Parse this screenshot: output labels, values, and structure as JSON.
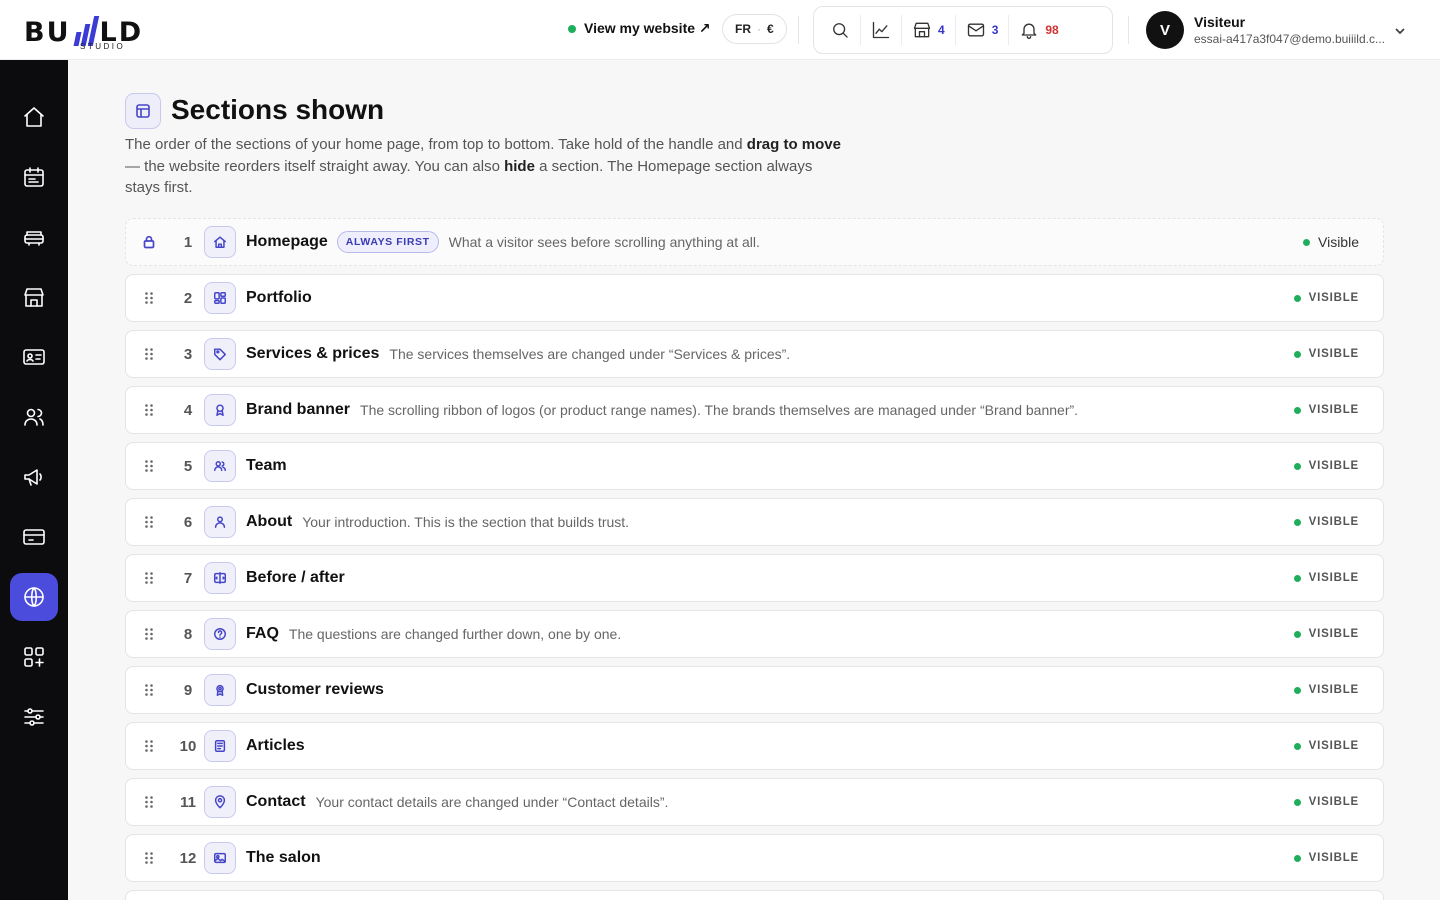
{
  "brand": {
    "name_left": "BU",
    "name_right": "LD",
    "sub": "STUDIO",
    "accent": "#3b3bd6"
  },
  "header": {
    "view_site": "View my website ↗",
    "lang": "FR",
    "currency": "€",
    "counts": {
      "shop": "4",
      "mail": "3",
      "bell": "98"
    },
    "user": {
      "initial": "V",
      "name": "Visiteur",
      "email": "essai-a417a3f047@demo.buiiild.c..."
    }
  },
  "sidebar": {
    "items": [
      {
        "icon": "home-icon"
      },
      {
        "icon": "calendar-icon"
      },
      {
        "icon": "services-icon"
      },
      {
        "icon": "storefront-icon"
      },
      {
        "icon": "contact-card-icon"
      },
      {
        "icon": "users-icon"
      },
      {
        "icon": "megaphone-icon"
      },
      {
        "icon": "payment-icon"
      },
      {
        "icon": "globe-icon",
        "active": true
      },
      {
        "icon": "apps-icon"
      },
      {
        "icon": "settings-sliders-icon"
      }
    ]
  },
  "page": {
    "title": "Sections shown",
    "intro_1": "The order of the sections of your home page, from top to bottom. Take hold of the handle and ",
    "intro_b1": "drag to move",
    "intro_2": " — the website reorders itself straight away. You can also ",
    "intro_b2": "hide",
    "intro_3": " a section. The Homepage section always stays first."
  },
  "sections": [
    {
      "num": "1",
      "name": "Homepage",
      "badge": "ALWAYS FIRST",
      "desc": "What a visitor sees before scrolling anything at all.",
      "status": "Visible",
      "icon": "home-icon"
    },
    {
      "num": "2",
      "name": "Portfolio",
      "desc": "",
      "status": "VISIBLE",
      "icon": "grid-icon"
    },
    {
      "num": "3",
      "name": "Services & prices",
      "desc": "The services themselves are changed under “Services & prices”.",
      "status": "VISIBLE",
      "icon": "tag-icon"
    },
    {
      "num": "4",
      "name": "Brand banner",
      "desc": "The scrolling ribbon of logos (or product range names). The brands themselves are managed under “Brand banner”.",
      "status": "VISIBLE",
      "icon": "award-icon"
    },
    {
      "num": "5",
      "name": "Team",
      "desc": "",
      "status": "VISIBLE",
      "icon": "team-icon"
    },
    {
      "num": "6",
      "name": "About",
      "desc": "Your introduction. This is the section that builds trust.",
      "status": "VISIBLE",
      "icon": "person-icon"
    },
    {
      "num": "7",
      "name": "Before / after",
      "desc": "",
      "status": "VISIBLE",
      "icon": "compare-icon"
    },
    {
      "num": "8",
      "name": "FAQ",
      "desc": "The questions are changed further down, one by one.",
      "status": "VISIBLE",
      "icon": "question-icon"
    },
    {
      "num": "9",
      "name": "Customer reviews",
      "desc": "",
      "status": "VISIBLE",
      "icon": "medal-icon"
    },
    {
      "num": "10",
      "name": "Articles",
      "desc": "",
      "status": "VISIBLE",
      "icon": "article-icon"
    },
    {
      "num": "11",
      "name": "Contact",
      "desc": "Your contact details are changed under “Contact details”.",
      "status": "VISIBLE",
      "icon": "location-pin-icon"
    },
    {
      "num": "12",
      "name": "The salon",
      "desc": "",
      "status": "VISIBLE",
      "icon": "image-icon"
    }
  ]
}
